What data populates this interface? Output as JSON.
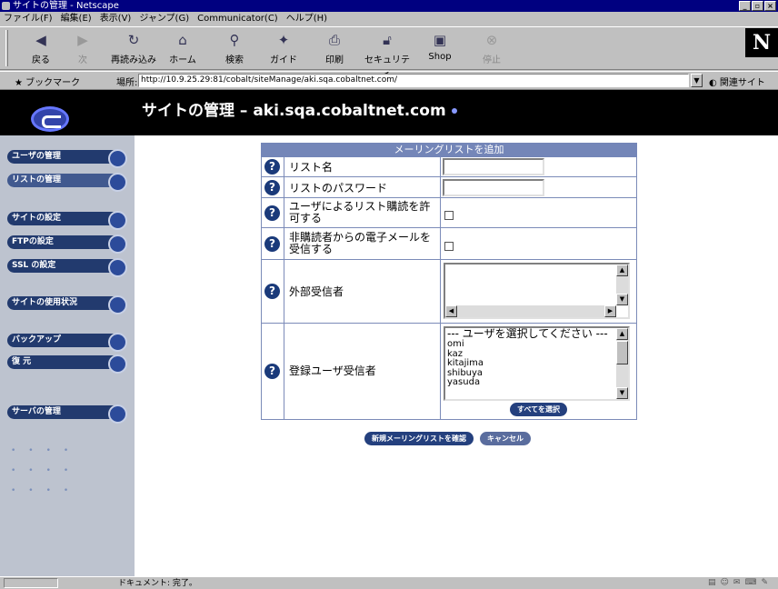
{
  "window": {
    "title": "サイトの管理 - Netscape"
  },
  "menu": [
    "ファイル(F)",
    "編集(E)",
    "表示(V)",
    "ジャンプ(G)",
    "Communicator(C)",
    "ヘルプ(H)"
  ],
  "toolbar": {
    "back": "戻る",
    "forward": "次",
    "reload": "再読み込み",
    "home": "ホーム",
    "search": "検索",
    "guide": "ガイド",
    "print": "印刷",
    "security": "セキュリティ",
    "shop": "Shop",
    "stop": "停止"
  },
  "location": {
    "bookmarks": "ブックマーク",
    "label": "場所:",
    "url": "http://10.9.25.29:81/cobalt/siteManage/aki.sqa.cobaltnet.com/",
    "related": "関連サイト"
  },
  "header": {
    "title": "サイトの管理 – aki.sqa.cobaltnet.com"
  },
  "sidebar": {
    "items": [
      {
        "label": "ユーザの管理"
      },
      {
        "label": "リストの管理"
      },
      {
        "label": "サイトの設定"
      },
      {
        "label": "FTPの設定"
      },
      {
        "label": "SSL の設定"
      },
      {
        "label": "サイトの使用状況"
      },
      {
        "label": "バックアップ"
      },
      {
        "label": "復 元"
      },
      {
        "label": "サーバの管理"
      }
    ]
  },
  "form": {
    "title": "メーリングリストを追加",
    "list_name_label": "リスト名",
    "list_name_value": "",
    "list_password_label": "リストのパスワード",
    "list_password_value": "",
    "allow_subscribe_label": "ユーザによるリスト購読を許可する",
    "accept_nonsubscriber_label": "非購読者からの電子メールを受信する",
    "external_recipients_label": "外部受信者",
    "registered_users_label": "登録ユーザ受信者",
    "user_options": [
      "--- ユーザを選択してください ---",
      "omi",
      "kaz",
      "kitajima",
      "shibuya",
      "yasuda"
    ],
    "select_all_button": "すべてを選択"
  },
  "actions": {
    "confirm": "新規メーリングリストを確認",
    "cancel": "キャンセル"
  },
  "status": {
    "message": "ドキュメント: 完了。"
  }
}
